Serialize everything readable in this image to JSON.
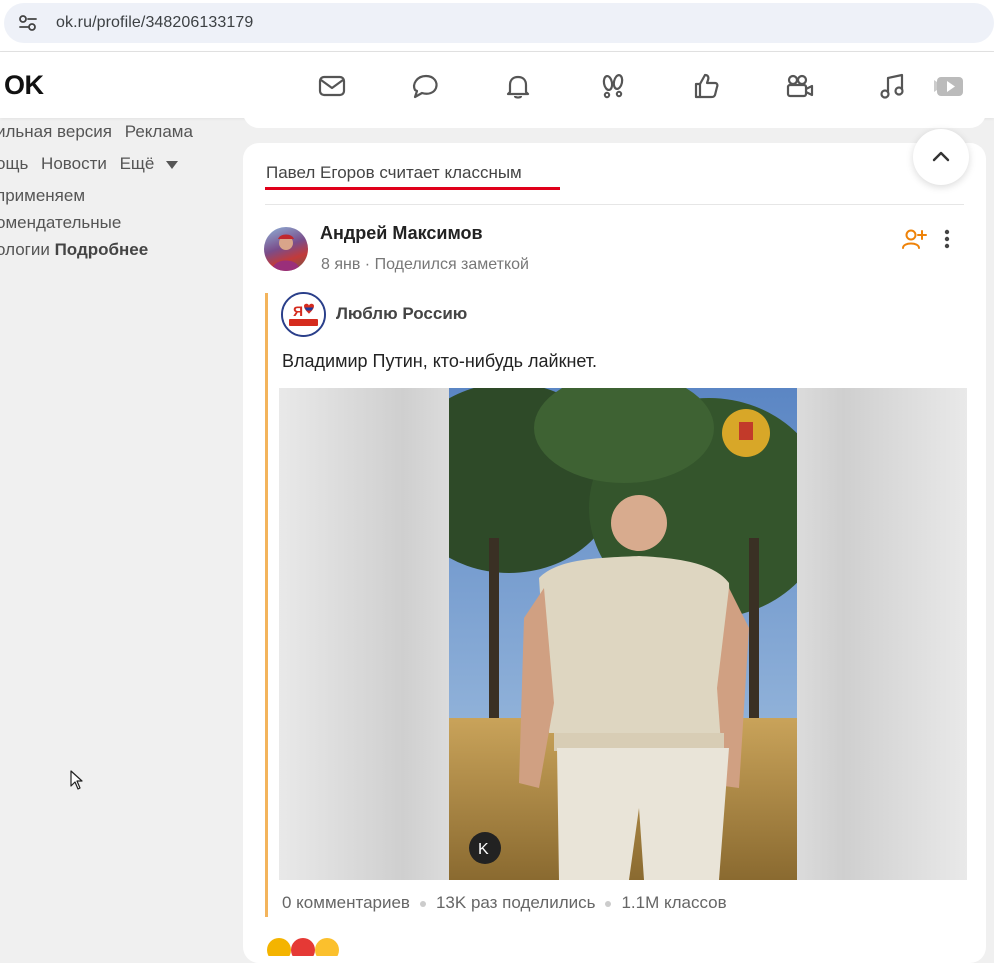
{
  "browser": {
    "url": "ok.ru/profile/348206133179"
  },
  "header": {
    "logo": "OK",
    "nav_icons": [
      "mail-icon",
      "discussions-icon",
      "notifications-icon",
      "guests-icon",
      "likes-icon",
      "video-icon",
      "music-icon",
      "video-play-icon"
    ]
  },
  "sidebar": {
    "line1": [
      "ильная версия",
      "Реклама"
    ],
    "line2": [
      "ощь",
      "Новости",
      "Ещё"
    ],
    "cookie_text_1": "применяем",
    "cookie_text_2": "омендательные",
    "cookie_text_3": "ологии",
    "cookie_more": "Подробнее"
  },
  "feed": {
    "title": "Павел Егоров считает классным",
    "post": {
      "author": "Андрей Максимов",
      "date": "8 янв",
      "action": "Поделился заметкой",
      "group_name": "Люблю Россию",
      "group_badge": "Я РОССИЮ!",
      "text": "Владимир Путин, кто-нибудь лайкнет.",
      "stats": {
        "comments": "0 комментариев",
        "shares": "13K раз поделились",
        "likes": "1.1M классов"
      }
    }
  },
  "colors": {
    "accent_orange": "#ee8208",
    "underline_red": "#e0001a",
    "repost_bar": "#f3b45c"
  }
}
